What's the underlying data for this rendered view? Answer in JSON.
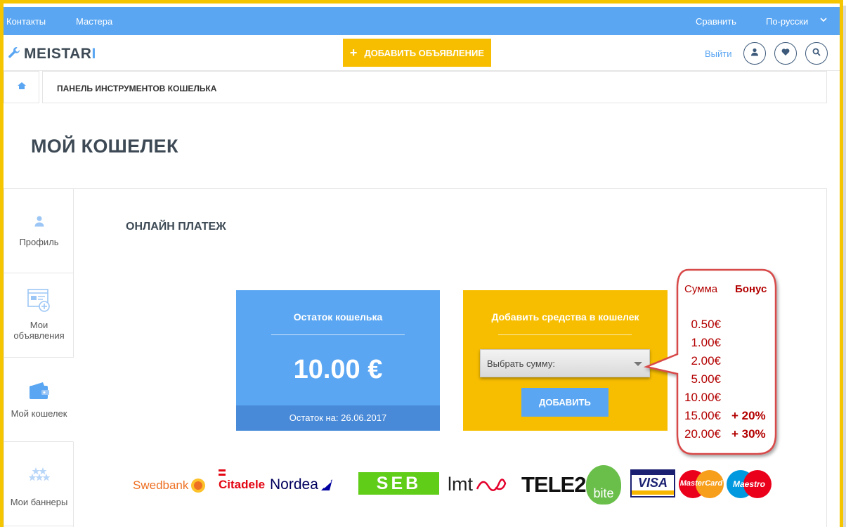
{
  "topbar": {
    "contacts": "Контакты",
    "masters": "Мастера",
    "compare": "Сравнить",
    "language": "По-русски"
  },
  "header": {
    "logo_main": "MEISTA",
    "logo_r": "R",
    "logo_i": "I",
    "add_ad": "ДОБАВИТЬ ОБЪЯВЛЕНИЕ",
    "logout": "Выйти"
  },
  "breadcrumb": {
    "current": "ПАНЕЛЬ ИНСТРУМЕНТОВ КОШЕЛЬКА"
  },
  "page": {
    "title": "МОЙ КОШЕЛЕК",
    "section": "ОНЛАЙН ПЛАТЕЖ"
  },
  "sidebar": {
    "items": [
      {
        "label": "Профиль",
        "icon": "user-icon"
      },
      {
        "label": "Мои объявления",
        "icon": "ads-icon"
      },
      {
        "label": "Мой кошелек",
        "icon": "wallet-icon"
      },
      {
        "label": "Мои баннеры",
        "icon": "stars-icon"
      }
    ]
  },
  "balance": {
    "heading": "Остаток кошелька",
    "amount": "10.00 €",
    "footer": "Остаток на: 26.06.2017"
  },
  "addfunds": {
    "heading": "Добавить средства в кошелек",
    "select_value": "Выбрать сумму:",
    "button": "ДОБАВИТЬ"
  },
  "bonus_table": {
    "col_sum": "Сумма",
    "col_bonus": "Бонус",
    "rows": [
      {
        "sum": "0.50€",
        "bonus": ""
      },
      {
        "sum": "1.00€",
        "bonus": ""
      },
      {
        "sum": "2.00€",
        "bonus": ""
      },
      {
        "sum": "5.00€",
        "bonus": ""
      },
      {
        "sum": "10.00€",
        "bonus": ""
      },
      {
        "sum": "15.00€",
        "bonus": "+ 20%"
      },
      {
        "sum": "20.00€",
        "bonus": "+ 30%"
      }
    ]
  },
  "payment_logos": {
    "swedbank": "Swedbank",
    "citadele": "Citadele",
    "nordea": "Nordea",
    "seb": "SEB",
    "lmt": "lmt",
    "tele2": "TELE2",
    "bite": "bite",
    "visa": "VISA",
    "mastercard": "MasterCard",
    "maestro": "Maestro"
  },
  "colors": {
    "blue": "#5aa6f2",
    "yellow": "#f7be00",
    "dark_blue": "#4889d8",
    "bonus_red": "#b30000"
  }
}
